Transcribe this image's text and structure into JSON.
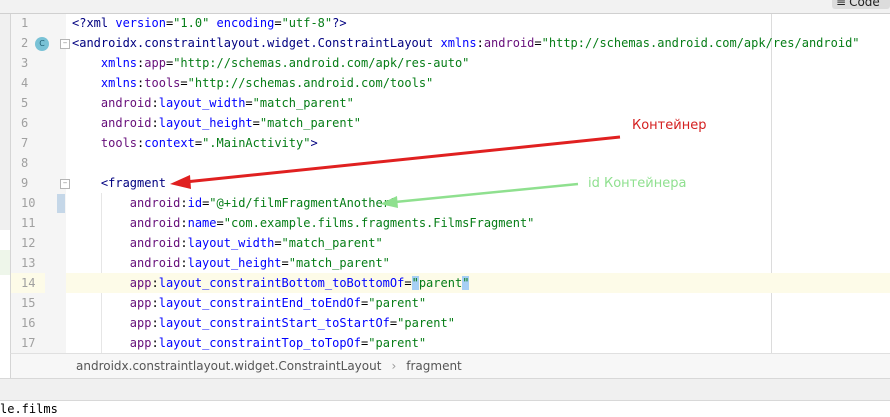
{
  "toolbar": {
    "code_label": "Code",
    "code_icon": "hamburger-icon"
  },
  "editor": {
    "lines": [
      {
        "n": "1",
        "tokens": [
          [
            "pi",
            "<?xml "
          ],
          [
            "attr",
            "version"
          ],
          [
            "plain",
            "="
          ],
          [
            "val",
            "\"1.0\""
          ],
          [
            "plain",
            " "
          ],
          [
            "attr",
            "encoding"
          ],
          [
            "plain",
            "="
          ],
          [
            "val",
            "\"utf-8\""
          ],
          [
            "pi",
            "?>"
          ]
        ]
      },
      {
        "n": "2",
        "badge": "C",
        "fold": true,
        "tokens": [
          [
            "tag",
            "<androidx.constraintlayout.widget.ConstraintLayout "
          ],
          [
            "xmlns",
            "xmlns"
          ],
          [
            "plain",
            ":"
          ],
          [
            "ns",
            "android"
          ],
          [
            "plain",
            "="
          ],
          [
            "val",
            "\"http://schemas.android.com/apk/res/android\""
          ]
        ]
      },
      {
        "n": "3",
        "tokens": [
          [
            "plain",
            "    "
          ],
          [
            "xmlns",
            "xmlns"
          ],
          [
            "plain",
            ":"
          ],
          [
            "ns",
            "app"
          ],
          [
            "plain",
            "="
          ],
          [
            "val",
            "\"http://schemas.android.com/apk/res-auto\""
          ]
        ]
      },
      {
        "n": "4",
        "tokens": [
          [
            "plain",
            "    "
          ],
          [
            "xmlns",
            "xmlns"
          ],
          [
            "plain",
            ":"
          ],
          [
            "ns",
            "tools"
          ],
          [
            "plain",
            "="
          ],
          [
            "val",
            "\"http://schemas.android.com/tools\""
          ]
        ]
      },
      {
        "n": "5",
        "tokens": [
          [
            "plain",
            "    "
          ],
          [
            "ns",
            "android"
          ],
          [
            "plain",
            ":"
          ],
          [
            "attr",
            "layout_width"
          ],
          [
            "plain",
            "="
          ],
          [
            "val",
            "\"match_parent\""
          ]
        ]
      },
      {
        "n": "6",
        "tokens": [
          [
            "plain",
            "    "
          ],
          [
            "ns",
            "android"
          ],
          [
            "plain",
            ":"
          ],
          [
            "attr",
            "layout_height"
          ],
          [
            "plain",
            "="
          ],
          [
            "val",
            "\"match_parent\""
          ]
        ]
      },
      {
        "n": "7",
        "tokens": [
          [
            "plain",
            "    "
          ],
          [
            "ns",
            "tools"
          ],
          [
            "plain",
            ":"
          ],
          [
            "attr",
            "context"
          ],
          [
            "plain",
            "="
          ],
          [
            "val",
            "\".MainActivity\""
          ],
          [
            "tag",
            ">"
          ]
        ]
      },
      {
        "n": "8",
        "tokens": []
      },
      {
        "n": "9",
        "fold": true,
        "tokens": [
          [
            "plain",
            "    "
          ],
          [
            "tag",
            "<fragment"
          ]
        ]
      },
      {
        "n": "10",
        "tokens": [
          [
            "plain",
            "        "
          ],
          [
            "ns",
            "android"
          ],
          [
            "plain",
            ":"
          ],
          [
            "attr",
            "id"
          ],
          [
            "plain",
            "="
          ],
          [
            "val",
            "\"@+id/filmFragmentAnother\""
          ]
        ]
      },
      {
        "n": "11",
        "tokens": [
          [
            "plain",
            "        "
          ],
          [
            "ns",
            "android"
          ],
          [
            "plain",
            ":"
          ],
          [
            "attr",
            "name"
          ],
          [
            "plain",
            "="
          ],
          [
            "val",
            "\"com.example.films.fragments.FilmsFragment\""
          ]
        ]
      },
      {
        "n": "12",
        "tokens": [
          [
            "plain",
            "        "
          ],
          [
            "ns",
            "android"
          ],
          [
            "plain",
            ":"
          ],
          [
            "attr",
            "layout_width"
          ],
          [
            "plain",
            "="
          ],
          [
            "val",
            "\"match_parent\""
          ]
        ]
      },
      {
        "n": "13",
        "tokens": [
          [
            "plain",
            "        "
          ],
          [
            "ns",
            "android"
          ],
          [
            "plain",
            ":"
          ],
          [
            "attr",
            "layout_height"
          ],
          [
            "plain",
            "="
          ],
          [
            "val",
            "\"match_parent\""
          ]
        ]
      },
      {
        "n": "14",
        "highlight": true,
        "tokens": [
          [
            "plain",
            "        "
          ],
          [
            "ns",
            "app"
          ],
          [
            "plain",
            ":"
          ],
          [
            "attr",
            "layout_constraintBottom_toBottomOf"
          ],
          [
            "plain",
            "="
          ],
          [
            "sel",
            "\""
          ],
          [
            "val",
            "parent"
          ],
          [
            "sel",
            "\""
          ]
        ]
      },
      {
        "n": "15",
        "tokens": [
          [
            "plain",
            "        "
          ],
          [
            "ns",
            "app"
          ],
          [
            "plain",
            ":"
          ],
          [
            "attr",
            "layout_constraintEnd_toEndOf"
          ],
          [
            "plain",
            "="
          ],
          [
            "val",
            "\"parent\""
          ]
        ]
      },
      {
        "n": "16",
        "tokens": [
          [
            "plain",
            "        "
          ],
          [
            "ns",
            "app"
          ],
          [
            "plain",
            ":"
          ],
          [
            "attr",
            "layout_constraintStart_toStartOf"
          ],
          [
            "plain",
            "="
          ],
          [
            "val",
            "\"parent\""
          ]
        ]
      },
      {
        "n": "17",
        "tokens": [
          [
            "plain",
            "        "
          ],
          [
            "ns",
            "app"
          ],
          [
            "plain",
            ":"
          ],
          [
            "attr",
            "layout_constraintTop_toTopOf"
          ],
          [
            "plain",
            "="
          ],
          [
            "val",
            "\"parent\""
          ]
        ]
      }
    ]
  },
  "breadcrumb": {
    "items": [
      "androidx.constraintlayout.widget.ConstraintLayout",
      "fragment"
    ],
    "separator": "›"
  },
  "bottom": {
    "text": "le.films"
  },
  "annotations": {
    "container_label": "Контейнер",
    "container_color": "#d42020",
    "id_label": "id Контейнера",
    "id_color": "#8fe08f"
  }
}
